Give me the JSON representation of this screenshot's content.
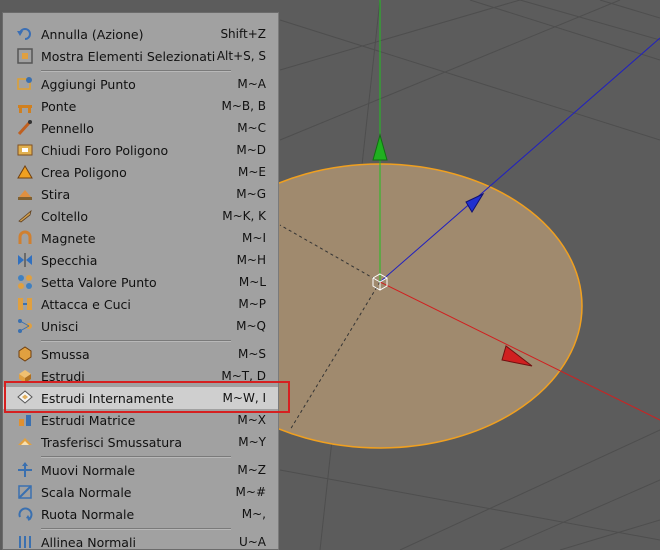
{
  "menu": {
    "items": [
      {
        "label": "Annulla (Azione)",
        "shortcut": "Shift+Z",
        "icon": "undo-icon",
        "color": "#3b6fb5"
      },
      {
        "label": "Mostra Elementi Selezionati",
        "shortcut": "Alt+S, S",
        "icon": "frame-selected-icon",
        "color": "#555555"
      },
      {
        "label": "Aggiungi Punto",
        "shortcut": "M~A",
        "icon": "add-point-icon",
        "color": "#e0a030"
      },
      {
        "label": "Ponte",
        "shortcut": "M~B, B",
        "icon": "bridge-icon",
        "color": "#d08020"
      },
      {
        "label": "Pennello",
        "shortcut": "M~C",
        "icon": "brush-icon",
        "color": "#c06020"
      },
      {
        "label": "Chiudi Foro Poligono",
        "shortcut": "M~D",
        "icon": "close-hole-icon",
        "color": "#e0b050"
      },
      {
        "label": "Crea Poligono",
        "shortcut": "M~E",
        "icon": "create-polygon-icon",
        "color": "#f0a020"
      },
      {
        "label": "Stira",
        "shortcut": "M~G",
        "icon": "iron-icon",
        "color": "#e09040"
      },
      {
        "label": "Coltello",
        "shortcut": "M~K, K",
        "icon": "knife-icon",
        "color": "#d0a050"
      },
      {
        "label": "Magnete",
        "shortcut": "M~I",
        "icon": "magnet-icon",
        "color": "#d08030"
      },
      {
        "label": "Specchia",
        "shortcut": "M~H",
        "icon": "mirror-icon",
        "color": "#3070c0"
      },
      {
        "label": "Setta Valore Punto",
        "shortcut": "M~L",
        "icon": "set-point-value-icon",
        "color": "#4080c0"
      },
      {
        "label": "Attacca e Cuci",
        "shortcut": "M~P",
        "icon": "stitch-sew-icon",
        "color": "#3a70b0"
      },
      {
        "label": "Unisci",
        "shortcut": "M~Q",
        "icon": "weld-icon",
        "color": "#3a70b0"
      },
      {
        "label": "Smussa",
        "shortcut": "M~S",
        "icon": "bevel-icon",
        "color": "#e0a040"
      },
      {
        "label": "Estrudi",
        "shortcut": "M~T, D",
        "icon": "extrude-icon",
        "color": "#e0a040"
      },
      {
        "label": "Estrudi Internamente",
        "shortcut": "M~W, I",
        "icon": "extrude-inner-icon",
        "color": "#e0b060"
      },
      {
        "label": "Estrudi Matrice",
        "shortcut": "M~X",
        "icon": "matrix-extrude-icon",
        "color": "#e09030"
      },
      {
        "label": "Trasferisci Smussatura",
        "shortcut": "M~Y",
        "icon": "smooth-shift-icon",
        "color": "#e0a040"
      },
      {
        "label": "Muovi Normale",
        "shortcut": "M~Z",
        "icon": "normal-move-icon",
        "color": "#3a70b0"
      },
      {
        "label": "Scala Normale",
        "shortcut": "M~#",
        "icon": "normal-scale-icon",
        "color": "#3a70b0"
      },
      {
        "label": "Ruota Normale",
        "shortcut": "M~,",
        "icon": "normal-rotate-icon",
        "color": "#3a70b0"
      },
      {
        "label": "Allinea Normali",
        "shortcut": "U~A",
        "icon": "align-normals-icon",
        "color": "#3a70b0"
      }
    ],
    "highlighted_label": "Estrudi Internamente",
    "highlight_color": "#d62020"
  },
  "viewport": {
    "disc_fill": "#a08a6e",
    "disc_outline": "#f0a020",
    "axis_x_color": "#d02020",
    "axis_y_color": "#20c020",
    "axis_z_color": "#2020c0",
    "background": "#5c5c5c"
  }
}
